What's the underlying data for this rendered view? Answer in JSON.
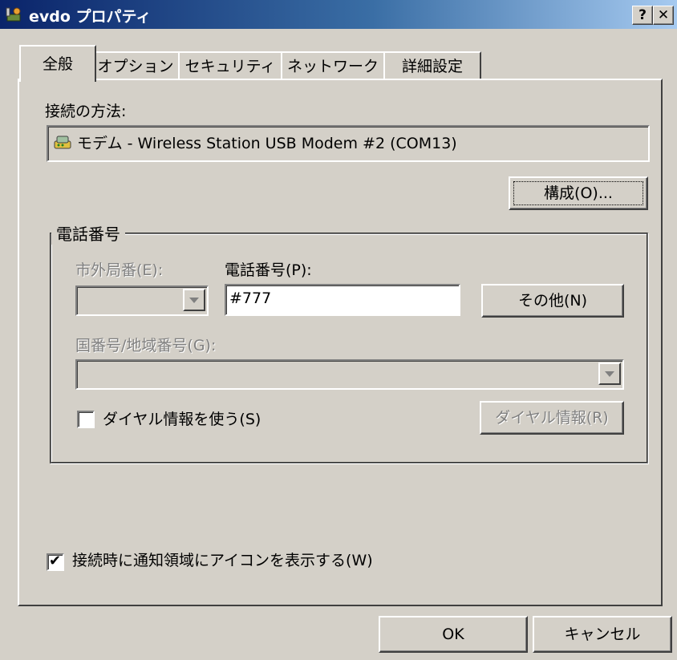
{
  "window": {
    "title": "evdo プロパティ",
    "help_label": "?",
    "close_label": "✕"
  },
  "tabs": [
    {
      "label": "全般",
      "active": true
    },
    {
      "label": "オプション",
      "active": false
    },
    {
      "label": "セキュリティ",
      "active": false
    },
    {
      "label": "ネットワーク",
      "active": false
    },
    {
      "label": "詳細設定",
      "active": false
    }
  ],
  "general": {
    "connect_using_label": "接続の方法:",
    "device_name": "モデム - Wireless Station USB Modem #2 (COM13)",
    "configure_button": "構成(O)...",
    "phone_group_label": "電話番号",
    "area_code_label": "市外局番(E):",
    "area_code_value": "",
    "phone_number_label": "電話番号(P):",
    "phone_number_value": "#777",
    "alternates_button": "その他(N)",
    "country_label": "国番号/地域番号(G):",
    "country_value": "",
    "use_dialing_rules_label": "ダイヤル情報を使う(S)",
    "use_dialing_rules_checked": false,
    "dialing_rules_button": "ダイヤル情報(R)",
    "show_icon_label": "接続時に通知領域にアイコンを表示する(W)",
    "show_icon_checked": true,
    "check_mark": "✔"
  },
  "footer": {
    "ok_button": "OK",
    "cancel_button": "キャンセル"
  }
}
